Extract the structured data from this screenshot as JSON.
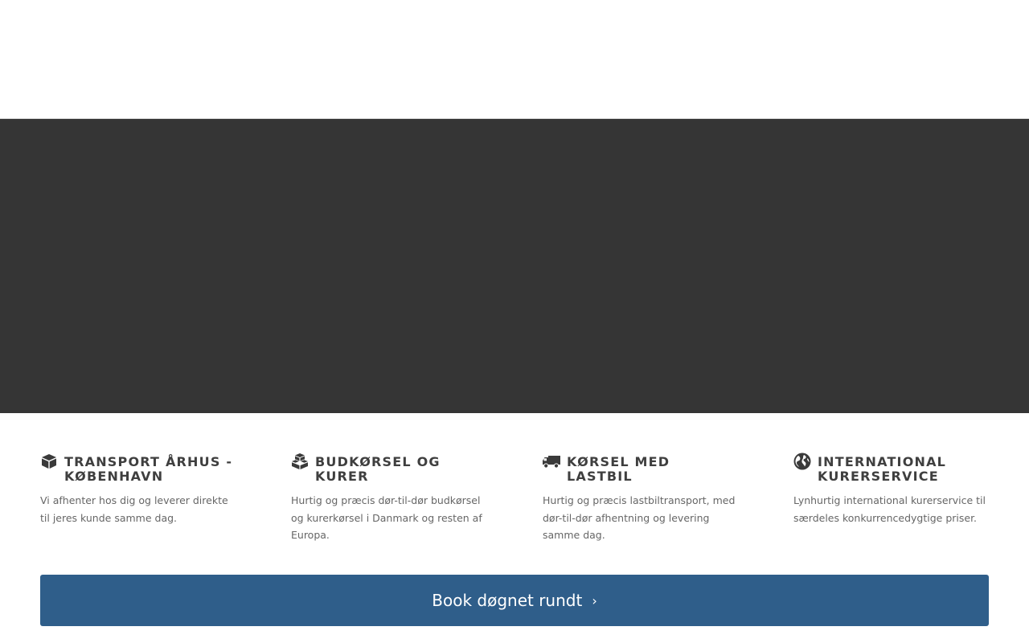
{
  "features": [
    {
      "icon": "cube-icon",
      "title": "TRANSPORT ÅRHUS - KØBENHAVN",
      "text": "Vi afhenter hos dig og leverer direkte til jeres kunde samme dag."
    },
    {
      "icon": "cubes-icon",
      "title": "BUDKØRSEL OG KURER",
      "text": "Hurtig og præcis dør-til-dør budkørsel og kurerkørsel i Danmark og resten af Europa."
    },
    {
      "icon": "truck-icon",
      "title": "KØRSEL MED LASTBIL",
      "text": "Hurtig og præcis lastbiltransport, med dør-til-dør afhentning og levering samme dag."
    },
    {
      "icon": "globe-icon",
      "title": "INTERNATIONAL KURERSERVICE",
      "text": "Lynhurtig international kurerservice til særdeles konkurrencedygtige priser."
    }
  ],
  "cta": {
    "label": "Book døgnet rundt",
    "icon": "chevron-right-icon"
  },
  "colors": {
    "hero_bg": "#353535",
    "button_bg": "#2f5e8a",
    "title_color": "#3f3f3f",
    "text_color": "#666666"
  }
}
